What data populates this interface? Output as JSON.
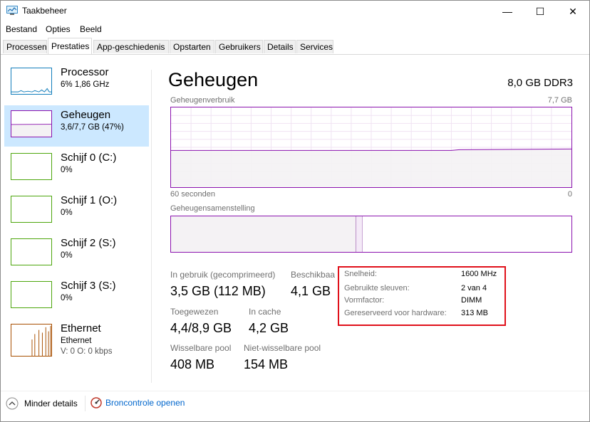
{
  "window": {
    "title": "Taakbeheer",
    "controls": {
      "minimize": "—",
      "maximize": "☐",
      "close": "✕"
    }
  },
  "menu": [
    "Bestand",
    "Opties",
    "Beeld"
  ],
  "tabs": [
    "Processen",
    "Prestaties",
    "App-geschiedenis",
    "Opstarten",
    "Gebruikers",
    "Details",
    "Services"
  ],
  "active_tab": "Prestaties",
  "sidebar": {
    "items": [
      {
        "name": "Processor",
        "sub": "6%  1,86 GHz",
        "sub2": "",
        "color": "#117dbb"
      },
      {
        "name": "Geheugen",
        "sub": "3,6/7,7 GB (47%)",
        "sub2": "",
        "color": "#8b12ae"
      },
      {
        "name": "Schijf 0 (C:)",
        "sub": "0%",
        "sub2": "",
        "color": "#4da60c"
      },
      {
        "name": "Schijf 1 (O:)",
        "sub": "0%",
        "sub2": "",
        "color": "#4da60c"
      },
      {
        "name": "Schijf 2 (S:)",
        "sub": "0%",
        "sub2": "",
        "color": "#4da60c"
      },
      {
        "name": "Schijf 3 (S:)",
        "sub": "0%",
        "sub2": "",
        "color": "#4da60c"
      },
      {
        "name": "Ethernet",
        "sub": "Ethernet",
        "sub2": "V: 0  O: 0 kbps",
        "color": "#a74f01"
      }
    ],
    "selected_index": 1
  },
  "main": {
    "title": "Geheugen",
    "spec": "8,0 GB DDR3",
    "usage_label": "Geheugenverbruik",
    "usage_max": "7,7 GB",
    "usage_level": 0.47,
    "time_left": "60 seconden",
    "time_right": "0",
    "composition_label": "Geheugensamenstelling",
    "composition_used_fraction": 0.46,
    "stats": {
      "in_use_label": "In gebruik (gecomprimeerd)",
      "in_use_value": "3,5 GB (112 MB)",
      "available_label": "Beschikbaar",
      "available_value": "4,1 GB",
      "committed_label": "Toegewezen",
      "committed_value": "4,4/8,9 GB",
      "cached_label": "In cache",
      "cached_value": "4,2 GB",
      "paged_label": "Wisselbare pool",
      "paged_value": "408 MB",
      "nonpaged_label": "Niet-wisselbare pool",
      "nonpaged_value": "154 MB"
    },
    "details": [
      {
        "key": "Snelheid:",
        "value": "1600 MHz"
      },
      {
        "key": "Gebruikte sleuven:",
        "value": "2 van 4"
      },
      {
        "key": "Vormfactor:",
        "value": "DIMM"
      },
      {
        "key": "Gereserveerd voor hardware:",
        "value": "313 MB"
      }
    ]
  },
  "footer": {
    "fewer_details": "Minder details",
    "resource_monitor": "Broncontrole openen"
  },
  "colors": {
    "memory": "#8b12ae",
    "highlight_box": "#e0101a",
    "selected": "#cce8ff"
  }
}
